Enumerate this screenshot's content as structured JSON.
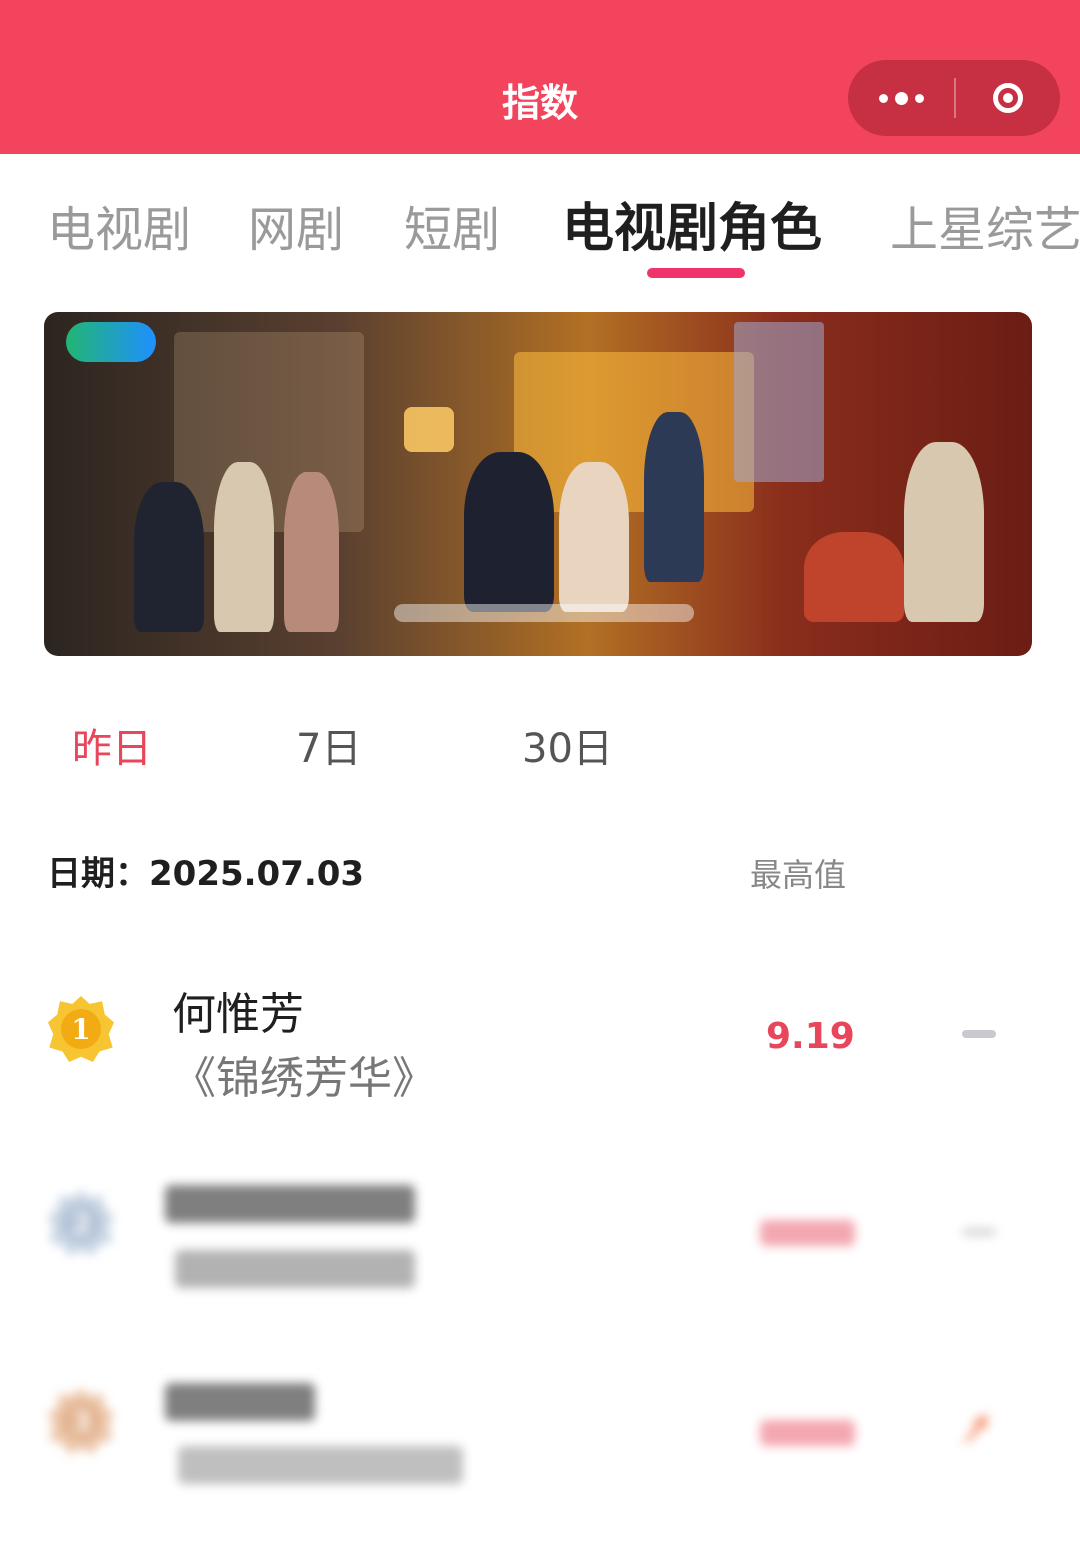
{
  "header": {
    "title": "指数"
  },
  "tabs": [
    {
      "label": "电视剧",
      "active": false
    },
    {
      "label": "网剧",
      "active": false
    },
    {
      "label": "短剧",
      "active": false
    },
    {
      "label": "电视剧角色",
      "active": true
    },
    {
      "label": "上星综艺",
      "active": false
    }
  ],
  "periods": [
    {
      "label": "昨日",
      "active": true
    },
    {
      "label": "7日",
      "active": false
    },
    {
      "label": "30日",
      "active": false
    }
  ],
  "date": {
    "text": "日期：2025.07.03"
  },
  "column_header": {
    "max_label": "最高值"
  },
  "rankings": [
    {
      "rank": "1",
      "name": "何惟芳",
      "show": "《锦绣芳华》",
      "value": "9.19",
      "trend": "flat"
    },
    {
      "rank": "2",
      "name": "",
      "show": "",
      "value": "",
      "trend": "flat",
      "blurred": true
    },
    {
      "rank": "3",
      "name": "",
      "show": "",
      "value": "",
      "trend": "up",
      "blurred": true
    }
  ],
  "colors": {
    "accent": "#f2455d",
    "tab_indicator": "#f0336a",
    "value_red": "#e8465a",
    "gold_badge": "#f7c531",
    "silver_badge": "#b9c9dc",
    "bronze_badge": "#e6b48f"
  }
}
